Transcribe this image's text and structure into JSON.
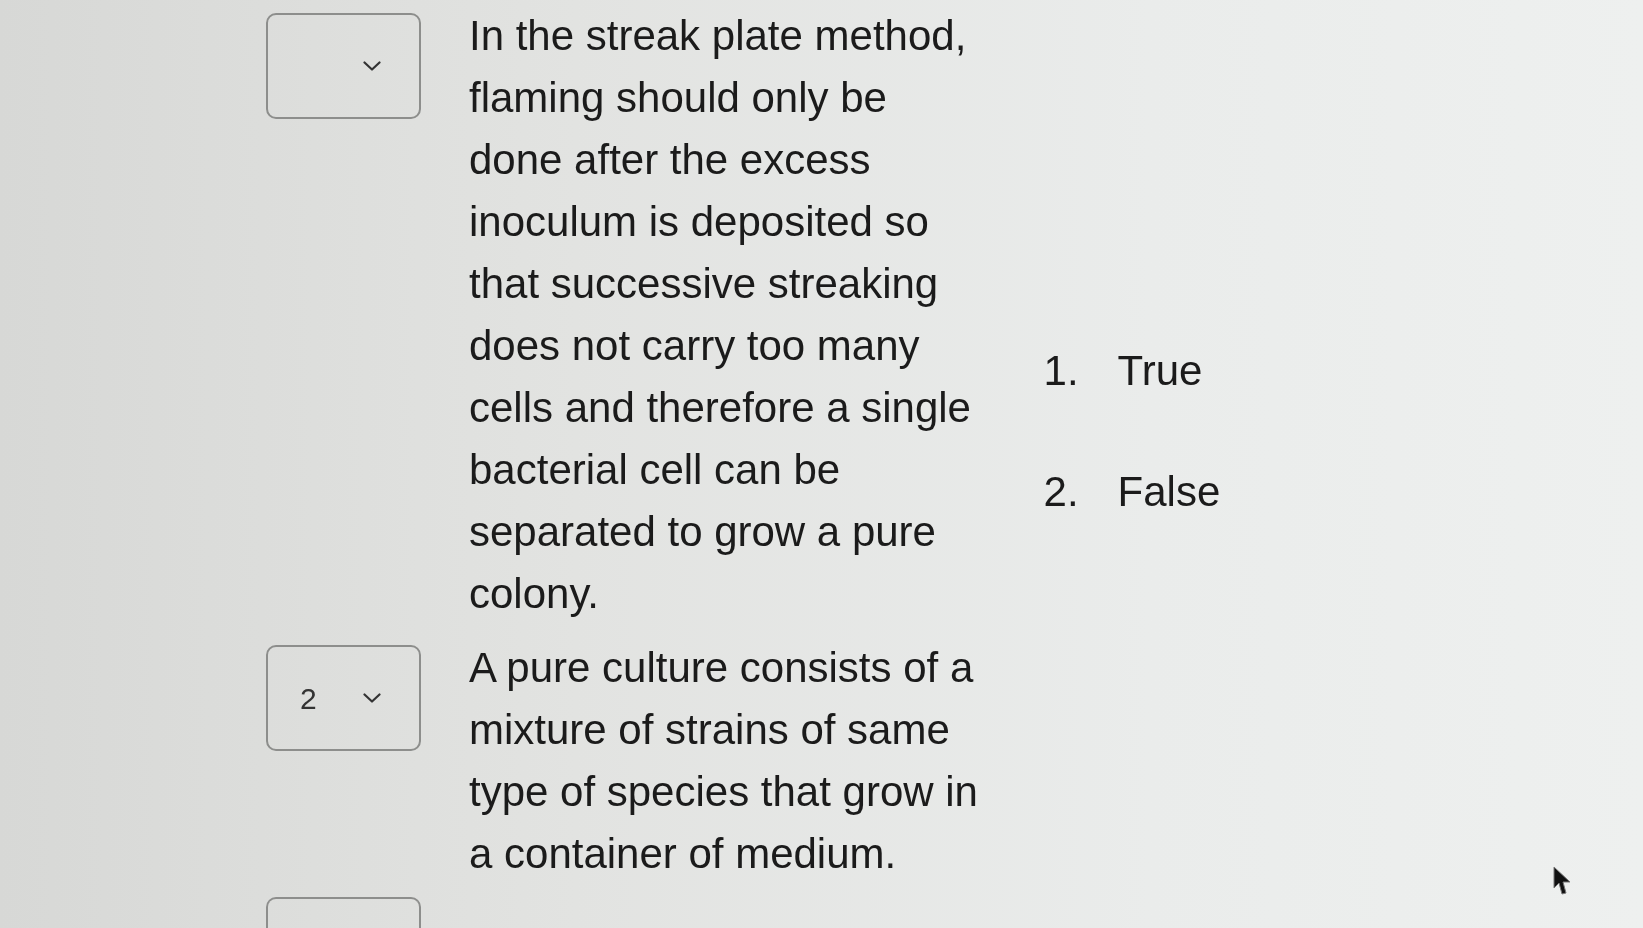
{
  "questions": [
    {
      "cut_off": false,
      "prompt": "In the streak plate method, flaming should only be done after the excess inoculum is deposited so that successive streaking does not carry too many cells and therefore a single bacterial cell can be separated to grow a pure colony."
    },
    {
      "cut_off": false,
      "answer": "2",
      "prompt": "A pure culture consists of a mixture of strains of same type of species that grow in a container of medium."
    },
    {
      "cut_off": true
    }
  ],
  "options": [
    {
      "number": "1.",
      "label": "True"
    },
    {
      "number": "2.",
      "label": "False"
    }
  ]
}
